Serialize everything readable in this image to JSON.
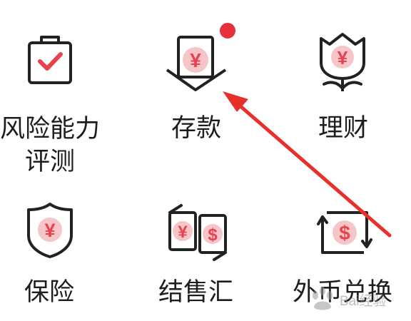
{
  "colors": {
    "accent": "#e8424f",
    "stroke": "#222222",
    "badge": "#e8303d",
    "arrow": "#e8302a"
  },
  "menu": {
    "risk_assessment": {
      "label": "风险能力评测",
      "icon": "clipboard-check-icon"
    },
    "deposit": {
      "label": "存款",
      "icon": "yuan-deposit-icon"
    },
    "wealth_management": {
      "label": "理财",
      "icon": "yuan-flower-icon"
    },
    "insurance": {
      "label": "保险",
      "icon": "yuan-shield-icon"
    },
    "fx_settlement": {
      "label": "结售汇",
      "icon": "yuan-dollar-exchange-icon"
    },
    "fx_exchange": {
      "label": "外币兑换",
      "icon": "dollar-exchange-icon"
    }
  },
  "watermark": {
    "text": "Bai经验"
  }
}
